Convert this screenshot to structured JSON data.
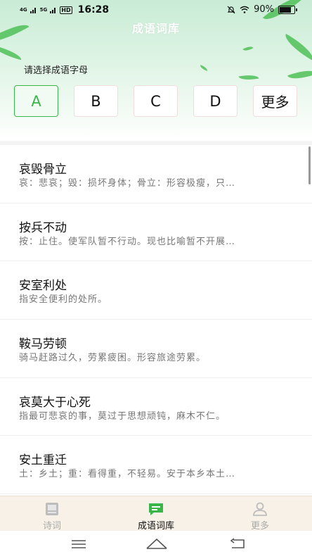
{
  "status_bar": {
    "signal1": "4G",
    "signal2": "5G",
    "hd": "HD",
    "time": "16:28",
    "battery_text": "90%",
    "battery_level": 0.9
  },
  "header": {
    "title": "成语词库"
  },
  "letter_picker": {
    "prompt": "请选择成语字母",
    "options": [
      "A",
      "B",
      "C",
      "D",
      "更多"
    ],
    "selected": "A"
  },
  "idioms": [
    {
      "word": "哀毁骨立",
      "desc": "哀：悲哀；毁：损坏身体；骨立：形容极瘦，只…"
    },
    {
      "word": "按兵不动",
      "desc": "按：止住。使军队暂不行动。现也比喻暂不开展…"
    },
    {
      "word": "安室利处",
      "desc": "指安全便利的处所。"
    },
    {
      "word": "鞍马劳顿",
      "desc": "骑马赶路过久，劳累疲困。形容旅途劳累。"
    },
    {
      "word": "哀莫大于心死",
      "desc": "指最可悲哀的事，莫过于思想顽钝，麻木不仁。"
    },
    {
      "word": "安土重迁",
      "desc": "土：乡土；重：看得重，不轻易。安于本乡本土…"
    }
  ],
  "tabs": [
    {
      "label": "诗词",
      "icon": "book-icon",
      "active": false
    },
    {
      "label": "成语词库",
      "icon": "chat-bubble-icon",
      "active": true
    },
    {
      "label": "更多",
      "icon": "person-icon",
      "active": false
    }
  ],
  "colors": {
    "accent": "#39b54a",
    "tab_bg": "#f7f1e7"
  }
}
